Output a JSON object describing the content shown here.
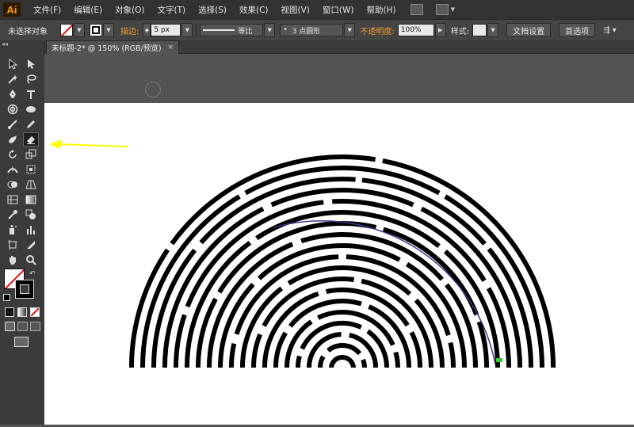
{
  "app": {
    "logo": "Ai",
    "menus": [
      "文件(F)",
      "编辑(E)",
      "对象(O)",
      "文字(T)",
      "选择(S)",
      "效果(C)",
      "视图(V)",
      "窗口(W)",
      "帮助(H)"
    ]
  },
  "controlbar": {
    "selection_status": "未选择对象",
    "stroke_label": "描边:",
    "stroke_value": "5 px",
    "line_profile_label": "等比",
    "brush_label": "3 点圆形",
    "opacity_label": "不透明度:",
    "opacity_value": "100%",
    "style_label": "样式:",
    "doc_settings_button": "文档设置",
    "preferences_button": "首选项"
  },
  "document": {
    "tab_title": "未标题-2* @ 150% (RGB/预览)",
    "tab_close": "×"
  },
  "toolbox": {
    "collapse_glyph": "◂◂",
    "tools": [
      "selection-tool",
      "direct-selection-tool",
      "magic-wand-tool",
      "lasso-tool",
      "pen-tool",
      "type-tool",
      "spiral-tool",
      "ellipse-tool",
      "paintbrush-tool",
      "pencil-tool",
      "blob-brush-tool",
      "eraser-tool",
      "rotate-tool",
      "scale-tool",
      "width-tool",
      "free-transform-tool",
      "shape-builder-tool",
      "perspective-grid-tool",
      "mesh-tool",
      "gradient-tool",
      "eyedropper-tool",
      "blend-tool",
      "symbol-sprayer-tool",
      "column-graph-tool",
      "artboard-tool",
      "slice-tool",
      "hand-tool",
      "zoom-tool"
    ],
    "selected_tool": "eraser-tool"
  },
  "colors": {
    "fill": "none",
    "stroke": "#000000",
    "annotation_arrow": "#ffff00",
    "selected_path": "#3a3a8a"
  },
  "artwork": {
    "description_icon": "semicircular-maze-arcs"
  }
}
